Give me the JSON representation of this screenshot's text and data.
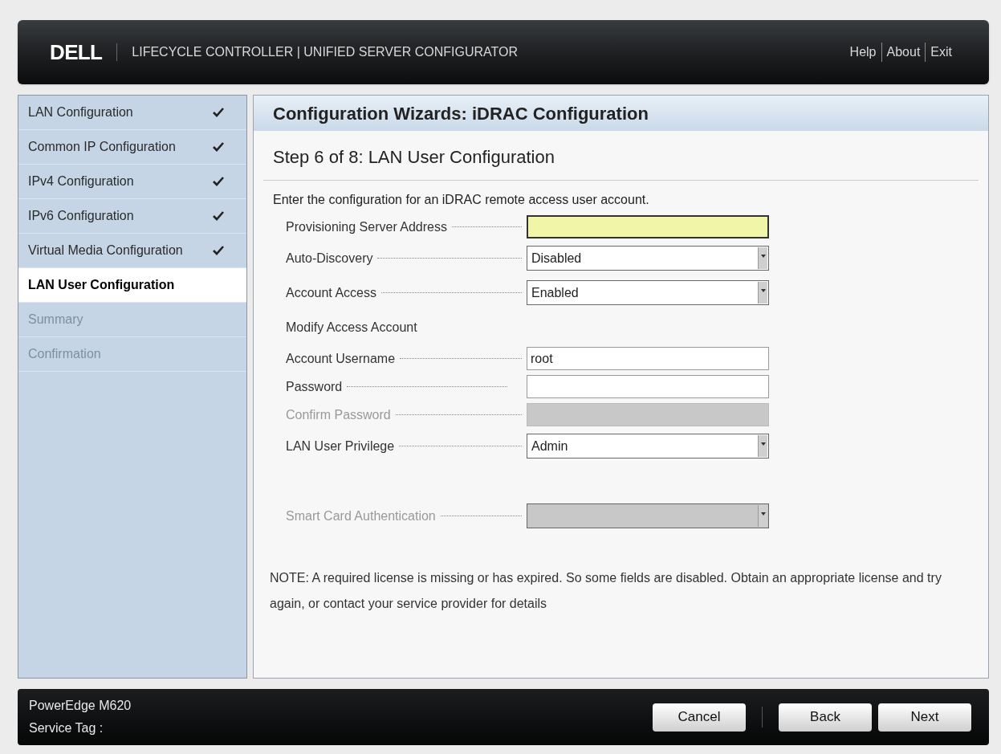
{
  "header": {
    "logo": "DELL",
    "title": "LIFECYCLE CONTROLLER | UNIFIED SERVER CONFIGURATOR",
    "links": [
      "Help",
      "About",
      "Exit"
    ]
  },
  "sidebar": {
    "items": [
      {
        "label": "LAN Configuration",
        "done": true,
        "selected": false,
        "disabled": false
      },
      {
        "label": "Common IP Configuration",
        "done": true,
        "selected": false,
        "disabled": false
      },
      {
        "label": "IPv4 Configuration",
        "done": true,
        "selected": false,
        "disabled": false
      },
      {
        "label": "IPv6 Configuration",
        "done": true,
        "selected": false,
        "disabled": false
      },
      {
        "label": "Virtual Media Configuration",
        "done": true,
        "selected": false,
        "disabled": false
      },
      {
        "label": "LAN User Configuration",
        "done": false,
        "selected": true,
        "disabled": false
      },
      {
        "label": "Summary",
        "done": false,
        "selected": false,
        "disabled": true
      },
      {
        "label": "Confirmation",
        "done": false,
        "selected": false,
        "disabled": true
      }
    ]
  },
  "main": {
    "title": "Configuration Wizards: iDRAC Configuration",
    "step": "Step 6 of 8: LAN User Configuration",
    "intro": "Enter the configuration for an iDRAC remote access user account.",
    "fields": [
      {
        "kind": "text",
        "label": "Provisioning Server Address",
        "focused": true,
        "disabled": false
      },
      {
        "kind": "select",
        "label": "Auto-Discovery",
        "value": "Disabled",
        "disabled": false
      },
      {
        "kind": "select",
        "label": "Account Access",
        "value": "Enabled",
        "disabled": false
      },
      {
        "kind": "heading",
        "label": "Modify Access Account"
      },
      {
        "kind": "text",
        "label": "Account Username",
        "value": "root",
        "focused": false,
        "disabled": false
      },
      {
        "kind": "text",
        "label": "Password",
        "focused": false,
        "disabled": false
      },
      {
        "kind": "text",
        "label": "Confirm Password",
        "focused": false,
        "disabled": true
      },
      {
        "kind": "select",
        "label": "LAN User Privilege",
        "value": "Admin",
        "disabled": false
      },
      {
        "kind": "spacer"
      },
      {
        "kind": "select",
        "label": "Smart Card Authentication",
        "disabled": true
      }
    ],
    "note": "NOTE: A required license is missing or has expired. So some fields are disabled. Obtain an appropriate license and try again, or contact your service provider for details"
  },
  "footer": {
    "model": "PowerEdge M620",
    "service_tag": "Service Tag :",
    "buttons": [
      "Cancel",
      "Back",
      "Next"
    ]
  }
}
